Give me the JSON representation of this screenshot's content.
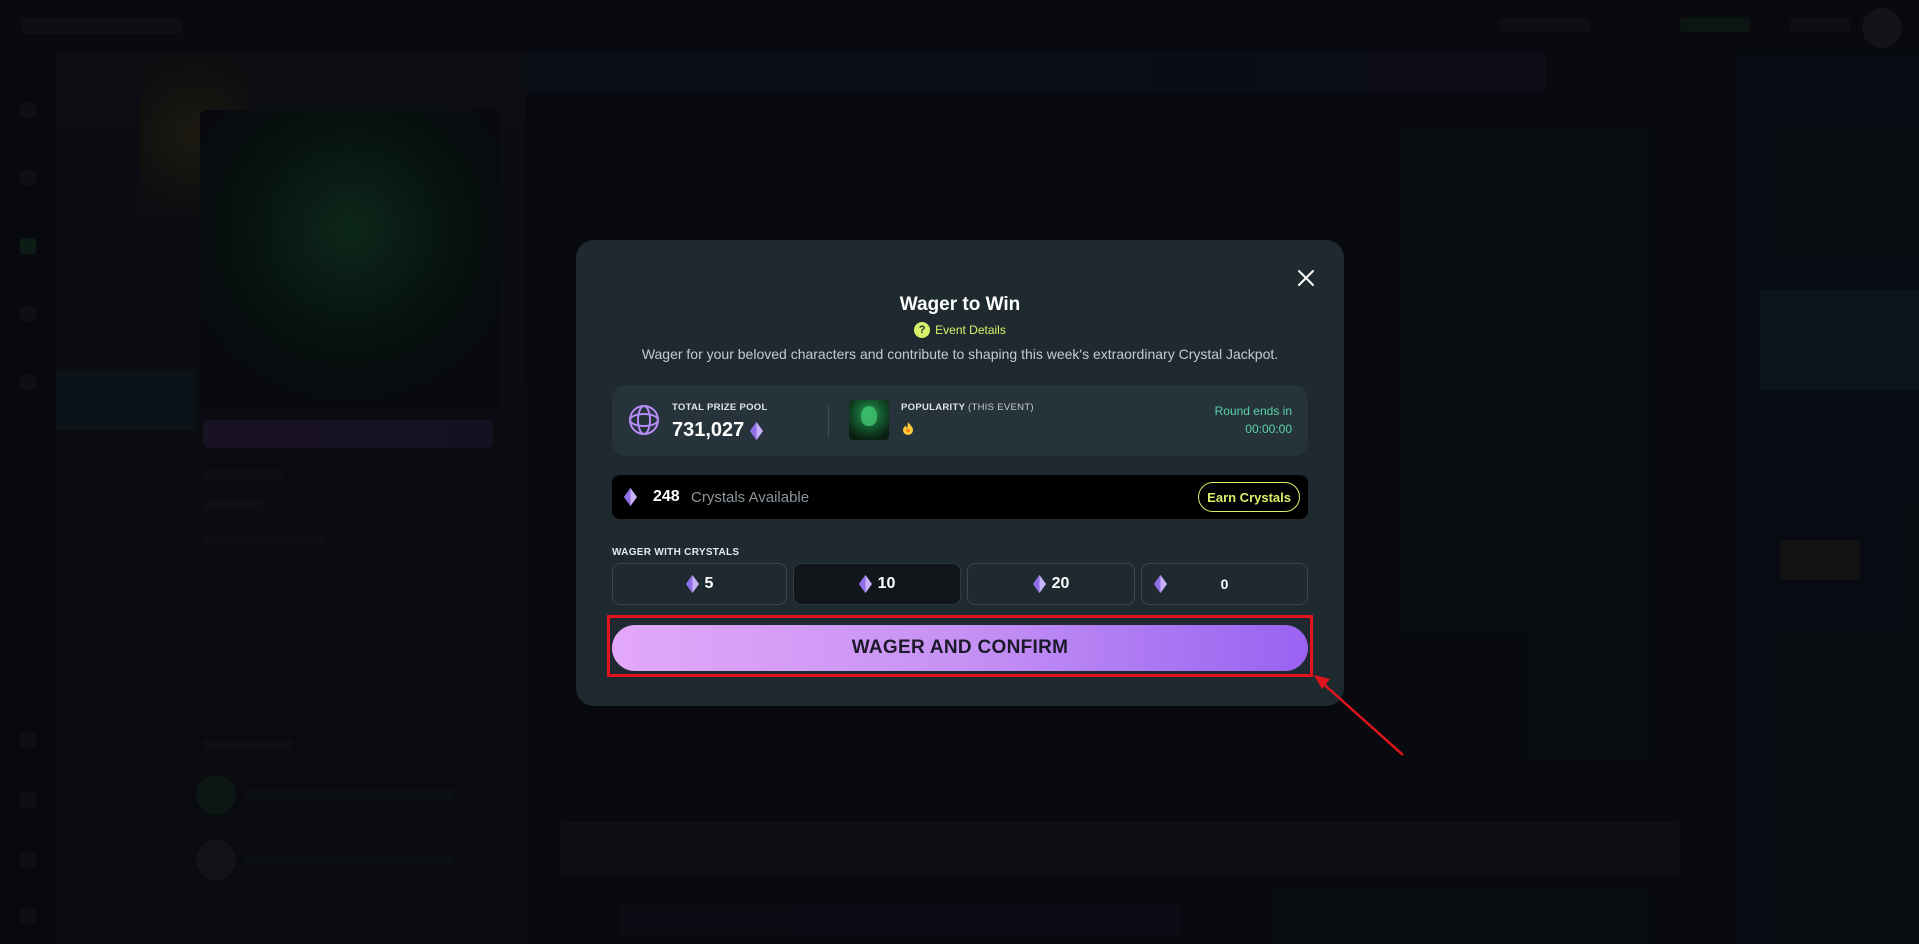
{
  "modal": {
    "title": "Wager to Win",
    "event_details": "Event Details",
    "help_glyph": "?",
    "subtitle": "Wager for your beloved characters and contribute to shaping this week's extraordinary Crystal Jackpot.",
    "close_icon": "close-icon"
  },
  "stats": {
    "prize_label": "TOTAL PRIZE POOL",
    "prize_value": "731,027",
    "popularity_label": "POPULARITY",
    "popularity_sub": "(THIS EVENT)",
    "popularity_icon": "flame-icon",
    "round_label": "Round ends in",
    "round_time": "00:00:00"
  },
  "crystals": {
    "count": "248",
    "label": "Crystals Available",
    "earn_button": "Earn Crystals"
  },
  "wager": {
    "label": "WAGER WITH CRYSTALS",
    "options": [
      "5",
      "10",
      "20"
    ],
    "custom_value": "0",
    "selected_option": "10",
    "confirm_button": "WAGER AND CONFIRM"
  },
  "colors": {
    "accent_lime": "#d8f26a",
    "accent_teal": "#57d4a8",
    "modal_bg": "#1f2a30",
    "button_gradient_start": "#e3a8f8",
    "button_gradient_end": "#9a62f2",
    "annotation_red": "#e0141c"
  }
}
